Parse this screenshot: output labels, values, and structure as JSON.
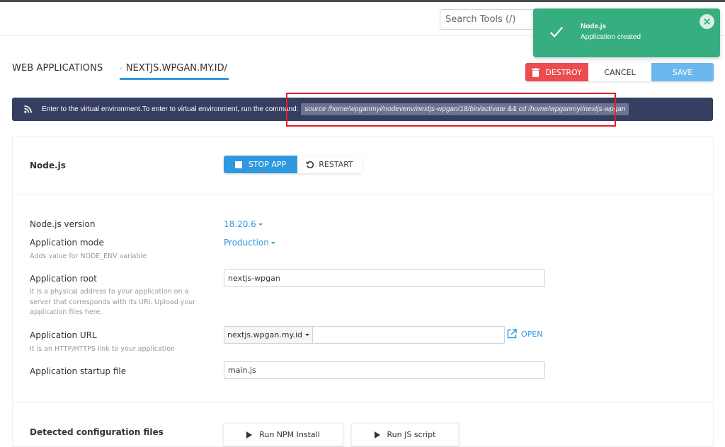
{
  "header": {
    "search_placeholder": "Search Tools (/)"
  },
  "toast": {
    "title": "Node.js",
    "message": "Application created",
    "color": "#36ae7f"
  },
  "tabs": {
    "web_applications": "WEB APPLICATIONS",
    "current_app": "NEXTJS.WPGAN.MY.ID/"
  },
  "actions": {
    "destroy": "DESTROY",
    "cancel": "CANCEL",
    "save": "SAVE"
  },
  "banner": {
    "text": "Enter to the virtual environment.To enter to virtual environment, run the command:",
    "command": "source /home/wpganmyi/nodevenv/nextjs-wpgan/18/bin/activate && cd /home/wpganmyi/nextjs-wpgan"
  },
  "app_section": {
    "title": "Node.js",
    "stop_label": "STOP APP",
    "restart_label": "RESTART"
  },
  "form": {
    "node_version_label": "Node.js version",
    "node_version_value": "18.20.6",
    "mode_label": "Application mode",
    "mode_value": "Production",
    "mode_hint": "Adds value for NODE_ENV variable",
    "root_label": "Application root",
    "root_value": "nextjs-wpgan",
    "root_hint": "It is a physical address to your application on a server that corresponds with its URI. Upload your application files here.",
    "url_label": "Application URL",
    "url_domain": "nextjs.wpgan.my.id",
    "url_path": "",
    "url_hint": "It is an HTTP/HTTPS link to your application",
    "open_label": "OPEN",
    "startup_label": "Application startup file",
    "startup_value": "main.js"
  },
  "config_section": {
    "title": "Detected configuration files",
    "run_npm_label": "Run NPM Install",
    "run_js_label": "Run JS script"
  }
}
